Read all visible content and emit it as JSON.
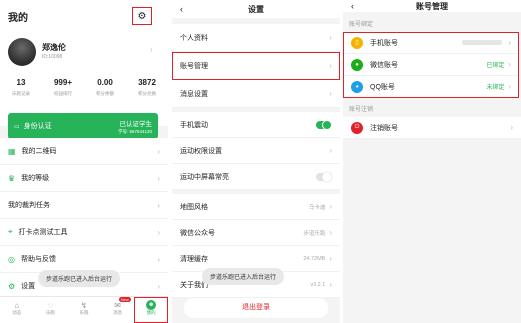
{
  "me": {
    "title": "我的",
    "user_name": "郑逸伦",
    "user_id": "ID:10098",
    "stats": [
      {
        "value": "13",
        "label": "乐跑记录"
      },
      {
        "value": "999+",
        "label": "校园排行"
      },
      {
        "value": "0.00",
        "label": "积分余额"
      },
      {
        "value": "3872",
        "label": "积分兑换"
      }
    ],
    "auth_label": "身份认证",
    "auth_status": "已认证学生",
    "auth_number": "学号: 567644120",
    "menu": [
      "我的二维码",
      "我的等级",
      "我的裁判任务",
      "打卡点测试工具",
      "帮助与反馈",
      "设置"
    ],
    "toast": "步道乐跑已进入后台运行",
    "tabs": [
      "动态",
      "乐跑",
      "乐跑",
      "消息",
      "我的"
    ],
    "badge": "New"
  },
  "settings": {
    "title": "设置",
    "items": [
      {
        "label": "个人资料",
        "value": ""
      },
      {
        "label": "账号管理",
        "value": ""
      },
      {
        "label": "消息设置",
        "value": ""
      },
      {
        "label": "手机震动",
        "value": ""
      },
      {
        "label": "运动权限设置",
        "value": ""
      },
      {
        "label": "运动中屏幕常亮",
        "value": ""
      },
      {
        "label": "地图风格",
        "value": "乌卡迪"
      },
      {
        "label": "微信公众号",
        "value": "步道乐跑"
      },
      {
        "label": "清理缓存",
        "value": "24.72MB"
      },
      {
        "label": "关于我们",
        "value": "v3.2.1"
      }
    ],
    "toast": "步道乐跑已进入后台运行",
    "logout": "退出登录"
  },
  "account": {
    "title": "账号管理",
    "bind_section": "账号绑定",
    "items": [
      {
        "label": "手机账号",
        "status": ""
      },
      {
        "label": "微信账号",
        "status": "已绑定"
      },
      {
        "label": "QQ账号",
        "status": "未绑定"
      }
    ],
    "cancel_section": "账号注销",
    "cancel_label": "注销账号"
  },
  "colors": {
    "brand_green": "#27b35a",
    "highlight_red": "#e0212a",
    "phone_yellow": "#f5b400",
    "wechat_green": "#1aad19",
    "qq_blue": "#1e9fe6"
  }
}
